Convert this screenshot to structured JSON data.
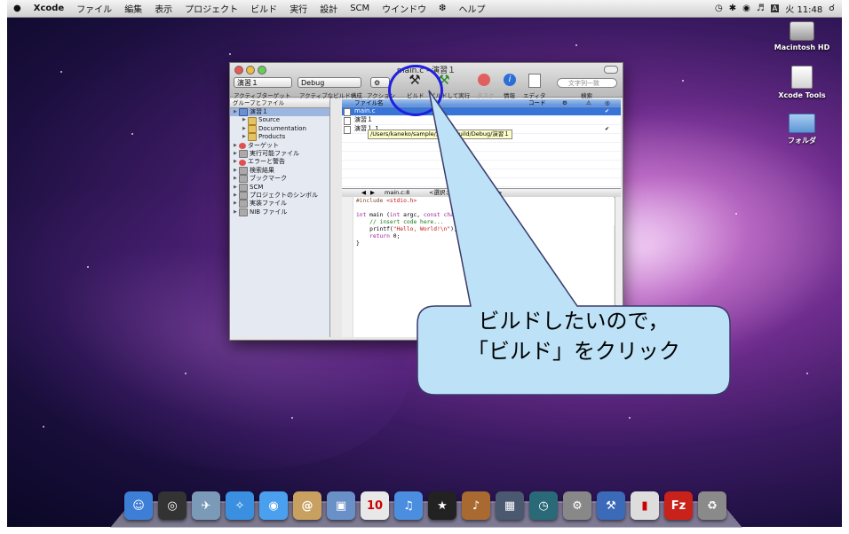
{
  "menubar": {
    "apple": "",
    "app": "Xcode",
    "items": [
      "ファイル",
      "編集",
      "表示",
      "プロジェクト",
      "ビルド",
      "実行",
      "設計",
      "SCM",
      "ウインドウ",
      "ヘルプ"
    ],
    "clock": "火 11:48",
    "input_menu": "A"
  },
  "desktop_icons": [
    {
      "label": "Macintosh HD",
      "icon": "hard-drive-icon"
    },
    {
      "label": "Xcode Tools",
      "icon": "disk-volume-icon"
    },
    {
      "label": "フォルダ",
      "icon": "folder-icon"
    }
  ],
  "window": {
    "title": "main.c - 演習１",
    "target_popup": "演習１",
    "config_popup": "Debug",
    "labels": {
      "active_target": "アクティブターゲット",
      "active_config": "アクティブなビルド構成",
      "action": "アクション",
      "build": "ビルド",
      "build_and_run": "ビルドして実行",
      "tasks": "タスク",
      "info": "情報",
      "editor": "エディタ",
      "search": "検索"
    },
    "search_placeholder": "文字列一致",
    "sidebar_header": "グループとファイル",
    "sidebar_items": [
      {
        "label": "演習１",
        "indent": 0,
        "icon": "project-icon",
        "selected": true
      },
      {
        "label": "Source",
        "indent": 1,
        "icon": "folder-icon"
      },
      {
        "label": "Documentation",
        "indent": 1,
        "icon": "folder-icon"
      },
      {
        "label": "Products",
        "indent": 1,
        "icon": "folder-icon"
      },
      {
        "label": "ターゲット",
        "indent": 0,
        "icon": "target-icon"
      },
      {
        "label": "実行可能ファイル",
        "indent": 0,
        "icon": "executable-icon"
      },
      {
        "label": "エラーと警告",
        "indent": 0,
        "icon": "warning-icon"
      },
      {
        "label": "検索結果",
        "indent": 0,
        "icon": "search-icon"
      },
      {
        "label": "ブックマーク",
        "indent": 0,
        "icon": "bookmark-icon"
      },
      {
        "label": "SCM",
        "indent": 0,
        "icon": "scm-icon"
      },
      {
        "label": "プロジェクトのシンボル",
        "indent": 0,
        "icon": "symbol-icon"
      },
      {
        "label": "実装ファイル",
        "indent": 0,
        "icon": "implementation-icon"
      },
      {
        "label": "NIB ファイル",
        "indent": 0,
        "icon": "nib-icon"
      }
    ],
    "file_header": {
      "name": "ファイル名",
      "code": "コード"
    },
    "files": [
      {
        "name": "main.c",
        "selected": true
      },
      {
        "name": "演習１"
      },
      {
        "name": "演習１.1"
      }
    ],
    "tooltip": "/Users/kaneko/sample/演習１/build/Debug/演習１",
    "nav": {
      "file": "main.c:8",
      "func": "<選択されたシンボルなし>"
    },
    "code_lines": [
      {
        "parts": [
          {
            "t": "#include ",
            "c": "pp"
          },
          {
            "t": "<stdio.h>",
            "c": "st"
          }
        ]
      },
      {
        "parts": [
          {
            "t": "",
            "c": ""
          }
        ]
      },
      {
        "parts": [
          {
            "t": "int",
            "c": "kw"
          },
          {
            "t": " main (",
            "c": ""
          },
          {
            "t": "int",
            "c": "kw"
          },
          {
            "t": " argc, ",
            "c": ""
          },
          {
            "t": "const char",
            "c": "kw"
          },
          {
            "t": " * argv[]) {",
            "c": ""
          }
        ]
      },
      {
        "parts": [
          {
            "t": "    // insert code here...",
            "c": "cm"
          }
        ]
      },
      {
        "parts": [
          {
            "t": "    printf(",
            "c": ""
          },
          {
            "t": "\"Hello, World!\\n\"",
            "c": "st"
          },
          {
            "t": ");",
            "c": ""
          }
        ]
      },
      {
        "parts": [
          {
            "t": "    ",
            "c": ""
          },
          {
            "t": "return",
            "c": "kw"
          },
          {
            "t": " 0;",
            "c": ""
          }
        ]
      },
      {
        "parts": [
          {
            "t": "}",
            "c": ""
          }
        ]
      }
    ]
  },
  "callout": {
    "line1": "ビルドしたいので，",
    "line2": "「ビルド」をクリック"
  },
  "dock": [
    {
      "icon": "finder-icon",
      "color": "#3d7fd6",
      "glyph": "☺"
    },
    {
      "icon": "dashboard-icon",
      "color": "#333333",
      "glyph": "◎"
    },
    {
      "icon": "mail-icon",
      "color": "#7a9ab8",
      "glyph": "✈"
    },
    {
      "icon": "safari-icon",
      "color": "#3a8fe0",
      "glyph": "✧"
    },
    {
      "icon": "ichat-icon",
      "color": "#4aa0ef",
      "glyph": "◉"
    },
    {
      "icon": "address-book-icon",
      "color": "#c8a060",
      "glyph": "@"
    },
    {
      "icon": "iphoto-icon",
      "color": "#6a90c8",
      "glyph": "▣"
    },
    {
      "icon": "ical-icon",
      "color": "#e8e8e8",
      "glyph": "10"
    },
    {
      "icon": "itunes-icon",
      "color": "#4b8ee0",
      "glyph": "♫"
    },
    {
      "icon": "imovie-icon",
      "color": "#222222",
      "glyph": "★"
    },
    {
      "icon": "garageband-icon",
      "color": "#a86a30",
      "glyph": "♪"
    },
    {
      "icon": "spaces-icon",
      "color": "#4a5870",
      "glyph": "▦"
    },
    {
      "icon": "time-machine-icon",
      "color": "#2a6a78",
      "glyph": "◷"
    },
    {
      "icon": "system-preferences-icon",
      "color": "#888888",
      "glyph": "⚙"
    },
    {
      "icon": "xcode-icon",
      "color": "#3a6ab8",
      "glyph": "⚒"
    },
    {
      "icon": "document-icon",
      "color": "#dddddd",
      "glyph": "▮"
    },
    {
      "icon": "filezilla-icon",
      "color": "#c8221a",
      "glyph": "Fz"
    },
    {
      "icon": "trash-icon",
      "color": "#8a8a8a",
      "glyph": "♻"
    }
  ]
}
